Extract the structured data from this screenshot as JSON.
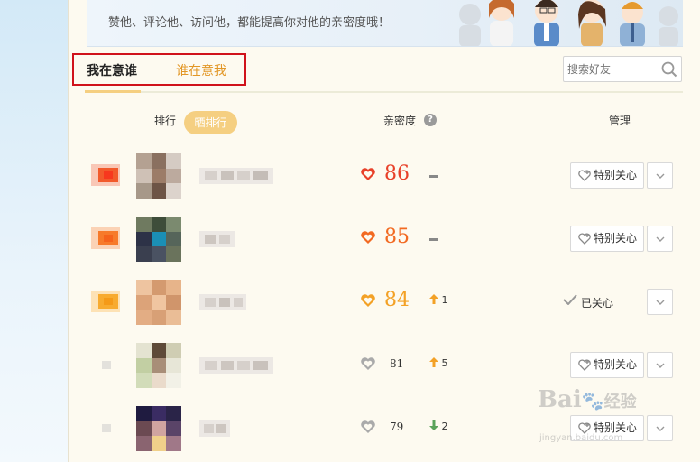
{
  "banner": {
    "text": "赞他、评论他、访问他，都能提高你对他的亲密度哦！"
  },
  "tabs": {
    "active": "我在意谁",
    "inactive": "谁在意我"
  },
  "search": {
    "placeholder": "搜索好友",
    "icon": "search-icon"
  },
  "table_header": {
    "rank": "排行",
    "share_rank": "晒排行",
    "intimacy": "亲密度",
    "manage": "管理"
  },
  "rows": [
    {
      "score": "86",
      "trend": "",
      "follow_label": "特别关心",
      "followed": false,
      "heart_color": "#e8412a",
      "rank_color": "#f25a2b"
    },
    {
      "score": "85",
      "trend": "",
      "follow_label": "特别关心",
      "followed": false,
      "heart_color": "#f26a22",
      "rank_color": "#f77a2a"
    },
    {
      "score": "84",
      "trend": "1",
      "follow_label": "已关心",
      "followed": true,
      "heart_color": "#f3a126",
      "rank_color": "#f8ab2f"
    },
    {
      "score": "81",
      "trend": "5",
      "follow_label": "特别关心",
      "followed": false,
      "heart_color": "#aaaaaa",
      "rank_color": "#dddddd"
    },
    {
      "score": "79",
      "trend": "2",
      "follow_label": "特别关心",
      "followed": false,
      "heart_color": "#aaaaaa",
      "rank_color": "#dddddd"
    }
  ],
  "watermark": {
    "logo": "Bai",
    "logo_cn": "经验",
    "url": "jingyan.baidu.com"
  }
}
